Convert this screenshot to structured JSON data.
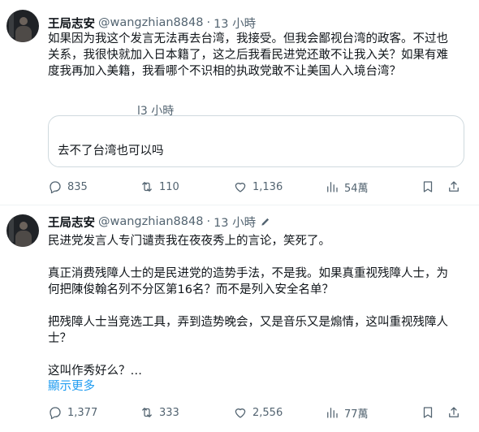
{
  "tweets": [
    {
      "author": {
        "display_name": "王局志安",
        "handle": "@wangzhian8848",
        "separator": "·",
        "time": "13 小時"
      },
      "text_lines": [
        "如果因为我这个发言无法再去台湾，我接受。但我会鄙视台湾的政客。不过也",
        "关系，我很快就加入日本籍了，这之后我看民进党还敢不让我入关？如果有难",
        "度我再加入美籍，我看哪个不识相的执政党敢不让美国人入境台湾？"
      ],
      "quote": {
        "time": "l3 小時",
        "text": "去不了台湾也可以吗"
      },
      "actions": {
        "replies": "835",
        "retweets": "110",
        "likes": "1,136",
        "views": "54萬"
      }
    },
    {
      "author": {
        "display_name": "王局志安",
        "handle": "@wangzhian8848",
        "separator": "·",
        "time": "13 小時"
      },
      "paragraphs": [
        [
          "民进党发言人专门谴责我在夜夜秀上的言论，笑死了。"
        ],
        [
          "真正消费残障人士的是民进党的造势手法，不是我。如果真重视残障人士，为",
          "何把陳俊翰名列不分区第16名？而不是列入安全名单？"
        ],
        [
          "把残障人士当竞选工具，弄到造势晚会，又是音乐又是煽情，这叫重视残障人",
          "士？"
        ],
        [
          "这叫作秀好么？…"
        ]
      ],
      "show_more": "顯示更多",
      "actions": {
        "replies": "1,377",
        "retweets": "333",
        "likes": "2,556",
        "views": "77萬"
      }
    }
  ],
  "icons": {
    "reply": "speech-bubble-icon",
    "retweet": "retweet-arrows-icon",
    "like": "heart-icon",
    "views": "bar-chart-icon",
    "bookmark": "bookmark-icon",
    "share": "share-upload-icon",
    "edit": "pencil-icon"
  },
  "colors": {
    "text": "#0f1419",
    "secondary": "#536471",
    "link": "#1d9bf0",
    "border": "#cfd9de"
  }
}
